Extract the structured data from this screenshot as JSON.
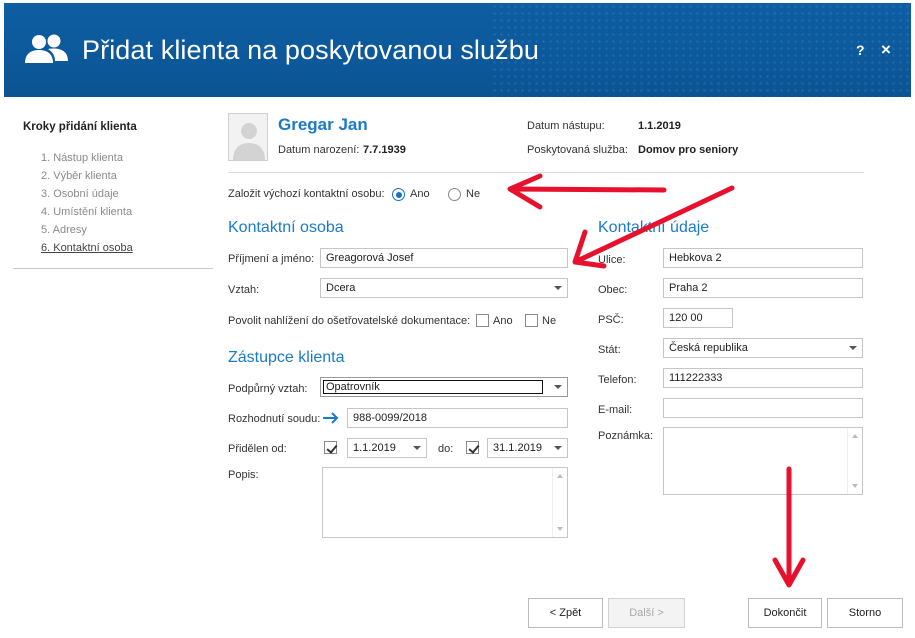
{
  "header": {
    "title": "Přidat klienta na poskytovanou službu",
    "help": "?",
    "close": "×"
  },
  "steps": {
    "title": "Kroky přidání klienta",
    "items": [
      "1. Nástup klienta",
      "2. Výběr klienta",
      "3. Osobní údaje",
      "4. Umístění klienta",
      "5. Adresy",
      "6. Kontaktní osoba"
    ],
    "active_index": 5
  },
  "client": {
    "name": "Gregar Jan",
    "birth_label": "Datum narození:",
    "birth_value": "7.7.1939",
    "start_label": "Datum nástupu:",
    "start_value": "1.1.2019",
    "service_label": "Poskytovaná služba:",
    "service_value": "Domov pro seniory"
  },
  "default_contact": {
    "label": "Založit výchozí kontaktní osobu:",
    "yes": "Ano",
    "no": "Ne",
    "selected": "Ano"
  },
  "contact": {
    "heading": "Kontaktní osoba",
    "name_label": "Příjmení a jméno:",
    "name_value": "Greagorová Josef",
    "relation_label": "Vztah:",
    "relation_value": "Dcera",
    "allow_label": "Povolit nahlížení do ošetřovatelské dokumentace:",
    "allow_yes": "Ano",
    "allow_no": "Ne"
  },
  "representative": {
    "heading": "Zástupce klienta",
    "support_label": "Podpůrný vztah:",
    "support_value": "Opatrovník",
    "court_label": "Rozhodnutí soudu:",
    "court_value": "988-0099/2018",
    "assigned_label": "Přidělen od:",
    "from_value": "1.1.2019",
    "to_label": "do:",
    "to_value": "31.1.2019",
    "desc_label": "Popis:"
  },
  "contact_info": {
    "heading": "Kontaktní údaje",
    "street_label": "Ulice:",
    "street_value": "Hebkova 2",
    "city_label": "Obec:",
    "city_value": "Praha 2",
    "zip_label": "PSČ:",
    "zip_value": "120 00",
    "state_label": "Stát:",
    "state_value": "Česká republika",
    "phone_label": "Telefon:",
    "phone_value": "111222333",
    "email_label": "E-mail:",
    "email_value": "",
    "note_label": "Poznámka:"
  },
  "buttons": {
    "back": "< Zpět",
    "next": "Další >",
    "finish": "Dokončit",
    "cancel": "Storno"
  },
  "colors": {
    "header_bg": "#0e5a9c",
    "accent": "#1a7bc9",
    "annotation_arrow": "#e8112d"
  }
}
